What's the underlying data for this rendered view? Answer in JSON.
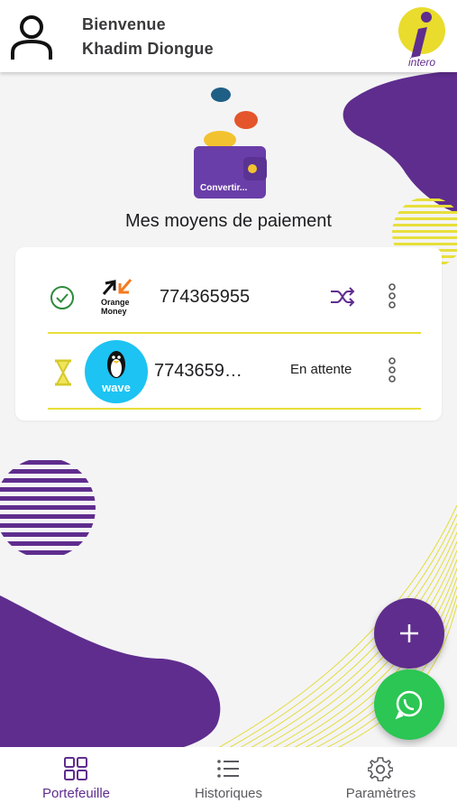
{
  "header": {
    "greeting": "Bienvenue",
    "user_name": "Khadim Diongue",
    "logo_text": "intero"
  },
  "wallet": {
    "button_label": "Convertir..."
  },
  "section_title": "Mes moyens de paiement",
  "payment_methods": [
    {
      "provider": "Orange Money",
      "provider_logo_lines": [
        "Orange",
        "Money"
      ],
      "number": "774365955",
      "status_icon": "check-circle-icon",
      "action_icon": "shuffle-icon",
      "menu_icon": "more-vertical-icon"
    },
    {
      "provider": "wave",
      "provider_logo_text": "wave",
      "number": "7743659…",
      "status_icon": "hourglass-icon",
      "status_text": "En attente",
      "menu_icon": "more-vertical-icon"
    }
  ],
  "fabs": {
    "add_icon": "plus-icon",
    "whatsapp_icon": "whatsapp-icon"
  },
  "bottom_nav": [
    {
      "label": "Portefeuille",
      "icon": "grid-icon",
      "active": true
    },
    {
      "label": "Historiques",
      "icon": "list-icon",
      "active": false
    },
    {
      "label": "Paramètres",
      "icon": "gear-icon",
      "active": false
    }
  ],
  "colors": {
    "primary_purple": "#5f2d8e",
    "accent_yellow": "#e7df3a",
    "whatsapp_green": "#2bc653",
    "coin_orange": "#e4552c",
    "coin_blue": "#1f5f86",
    "coin_gold": "#f2c230"
  }
}
